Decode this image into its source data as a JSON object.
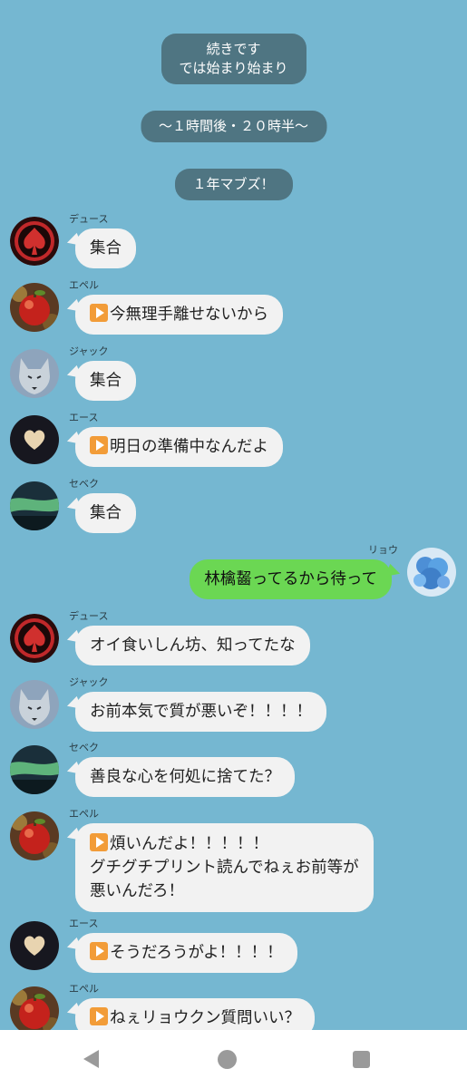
{
  "system_messages": [
    "続きです\nでは始まり始まり",
    "〜１時間後・２０時半〜",
    "１年マブズ！"
  ],
  "messages": [
    {
      "sender": "デュース",
      "text": "集合",
      "play": false
    },
    {
      "sender": "エペル",
      "text": "今無理手離せないから",
      "play": true
    },
    {
      "sender": "ジャック",
      "text": "集合",
      "play": false
    },
    {
      "sender": "エース",
      "text": "明日の準備中なんだよ",
      "play": true
    },
    {
      "sender": "セベク",
      "text": "集合",
      "play": false
    },
    {
      "sender": "リョウ",
      "text": "林檎齧ってるから待って",
      "play": false,
      "outgoing": true
    },
    {
      "sender": "デュース",
      "text": "オイ食いしん坊、知ってたな",
      "play": false
    },
    {
      "sender": "ジャック",
      "text": "お前本気で質が悪いぞ！！！！",
      "play": false
    },
    {
      "sender": "セベク",
      "text": "善良な心を何処に捨てた？",
      "play": false
    },
    {
      "sender": "エペル",
      "text": "煩いんだよ！！！！！\nグチグチプリント読んでねぇお前等が\n悪いんだろ！",
      "play": true
    },
    {
      "sender": "エース",
      "text": "そうだろうがよ！！！！",
      "play": true
    },
    {
      "sender": "エペル",
      "text": "ねぇリョウクン質問いい？",
      "play": true
    }
  ],
  "colors": {
    "background": "#75b7d1",
    "system_pill": "#4f7582",
    "incoming_bubble": "#f2f2f2",
    "outgoing_bubble": "#6bd753",
    "play_badge": "#f29c38"
  },
  "icons": [
    "spade-avatar-icon",
    "apple-avatar-icon",
    "wolf-avatar-icon",
    "heart-avatar-icon",
    "aurora-avatar-icon",
    "blue-flower-avatar-icon",
    "play-icon",
    "back-icon",
    "home-icon",
    "recents-icon"
  ]
}
